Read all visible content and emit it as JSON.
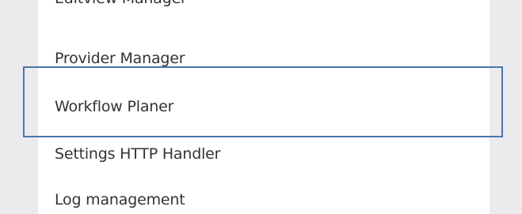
{
  "menu": {
    "items": [
      {
        "label": "Editview Manager"
      },
      {
        "label": "Provider Manager"
      },
      {
        "label": "Workflow Planer"
      },
      {
        "label": "Settings HTTP Handler"
      },
      {
        "label": "Log management"
      }
    ],
    "highlighted_index": 2
  },
  "colors": {
    "background": "#ebebed",
    "panel": "#ffffff",
    "text": "#333333",
    "highlight_border": "#4a74b0"
  }
}
